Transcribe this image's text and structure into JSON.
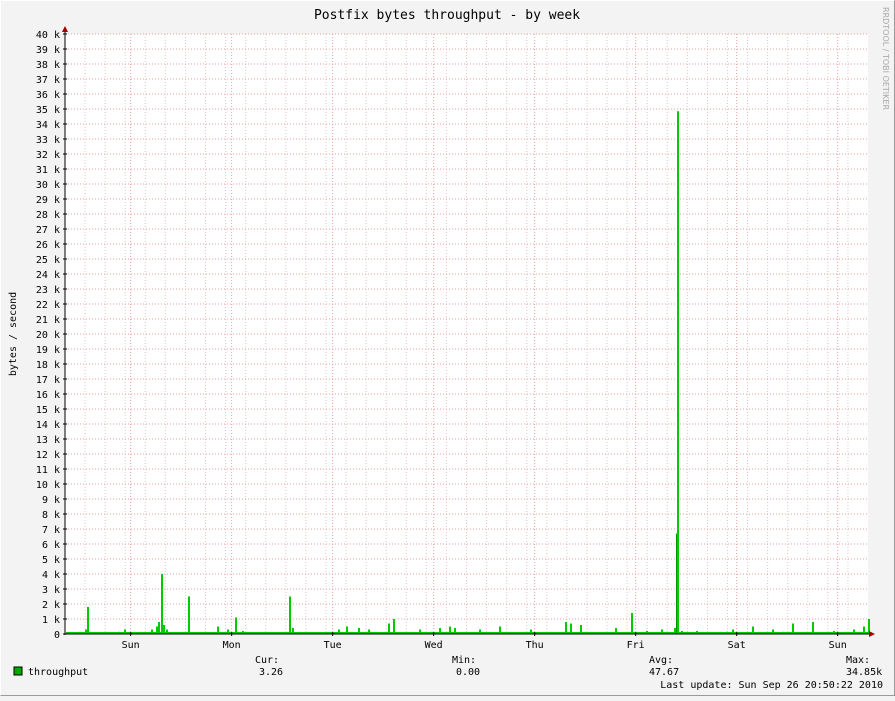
{
  "chart_data": {
    "type": "area",
    "title": "Postfix bytes throughput - by week",
    "ylabel": "bytes / second",
    "watermark": "RRDTOOL / TOBI OETIKER",
    "ylim": [
      0,
      40000
    ],
    "yticks": [
      {
        "value": 0,
        "label": "0"
      },
      {
        "value": 1000,
        "label": "1 k"
      },
      {
        "value": 2000,
        "label": "2 k"
      },
      {
        "value": 3000,
        "label": "3 k"
      },
      {
        "value": 4000,
        "label": "4 k"
      },
      {
        "value": 5000,
        "label": "5 k"
      },
      {
        "value": 6000,
        "label": "6 k"
      },
      {
        "value": 7000,
        "label": "7 k"
      },
      {
        "value": 8000,
        "label": "8 k"
      },
      {
        "value": 9000,
        "label": "9 k"
      },
      {
        "value": 10000,
        "label": "10 k"
      },
      {
        "value": 11000,
        "label": "11 k"
      },
      {
        "value": 12000,
        "label": "12 k"
      },
      {
        "value": 13000,
        "label": "13 k"
      },
      {
        "value": 14000,
        "label": "14 k"
      },
      {
        "value": 15000,
        "label": "15 k"
      },
      {
        "value": 16000,
        "label": "16 k"
      },
      {
        "value": 17000,
        "label": "17 k"
      },
      {
        "value": 18000,
        "label": "18 k"
      },
      {
        "value": 19000,
        "label": "19 k"
      },
      {
        "value": 20000,
        "label": "20 k"
      },
      {
        "value": 21000,
        "label": "21 k"
      },
      {
        "value": 22000,
        "label": "22 k"
      },
      {
        "value": 23000,
        "label": "23 k"
      },
      {
        "value": 24000,
        "label": "24 k"
      },
      {
        "value": 25000,
        "label": "25 k"
      },
      {
        "value": 26000,
        "label": "26 k"
      },
      {
        "value": 27000,
        "label": "27 k"
      },
      {
        "value": 28000,
        "label": "28 k"
      },
      {
        "value": 29000,
        "label": "29 k"
      },
      {
        "value": 30000,
        "label": "30 k"
      },
      {
        "value": 31000,
        "label": "31 k"
      },
      {
        "value": 32000,
        "label": "32 k"
      },
      {
        "value": 33000,
        "label": "33 k"
      },
      {
        "value": 34000,
        "label": "34 k"
      },
      {
        "value": 35000,
        "label": "35 k"
      },
      {
        "value": 36000,
        "label": "36 k"
      },
      {
        "value": 37000,
        "label": "37 k"
      },
      {
        "value": 38000,
        "label": "38 k"
      },
      {
        "value": 39000,
        "label": "39 k"
      },
      {
        "value": 40000,
        "label": "40 k"
      }
    ],
    "xlim": [
      0,
      7.95
    ],
    "xticks": [
      {
        "value": 0.65,
        "label": "Sun"
      },
      {
        "value": 1.65,
        "label": "Mon"
      },
      {
        "value": 2.65,
        "label": "Tue"
      },
      {
        "value": 3.65,
        "label": "Wed"
      },
      {
        "value": 4.65,
        "label": "Thu"
      },
      {
        "value": 5.65,
        "label": "Fri"
      },
      {
        "value": 6.65,
        "label": "Sat"
      },
      {
        "value": 7.65,
        "label": "Sun"
      }
    ],
    "grid": true,
    "series": [
      {
        "name": "throughput",
        "color": "#00cc00",
        "spikes": [
          [
            0.22,
            1800
          ],
          [
            0.2,
            300
          ],
          [
            0.58,
            300
          ],
          [
            0.85,
            300
          ],
          [
            0.9,
            500
          ],
          [
            0.92,
            800
          ],
          [
            0.95,
            4000
          ],
          [
            0.97,
            600
          ],
          [
            1.0,
            300
          ],
          [
            1.22,
            2500
          ],
          [
            1.22,
            500
          ],
          [
            1.5,
            500
          ],
          [
            1.6,
            300
          ],
          [
            1.68,
            1100
          ],
          [
            1.75,
            200
          ],
          [
            2.22,
            2500
          ],
          [
            2.25,
            400
          ],
          [
            2.7,
            300
          ],
          [
            2.78,
            500
          ],
          [
            2.9,
            400
          ],
          [
            3.0,
            300
          ],
          [
            3.2,
            700
          ],
          [
            3.25,
            1000
          ],
          [
            3.5,
            300
          ],
          [
            3.7,
            400
          ],
          [
            3.8,
            500
          ],
          [
            3.85,
            400
          ],
          [
            4.1,
            300
          ],
          [
            4.3,
            500
          ],
          [
            4.6,
            300
          ],
          [
            4.95,
            800
          ],
          [
            5.0,
            700
          ],
          [
            5.1,
            600
          ],
          [
            5.45,
            400
          ],
          [
            5.6,
            1400
          ],
          [
            5.75,
            200
          ],
          [
            5.9,
            300
          ],
          [
            6.03,
            400
          ],
          [
            6.05,
            6700
          ],
          [
            6.06,
            34850
          ],
          [
            6.1,
            200
          ],
          [
            6.25,
            200
          ],
          [
            6.6,
            300
          ],
          [
            6.8,
            500
          ],
          [
            7.0,
            300
          ],
          [
            7.2,
            700
          ],
          [
            7.4,
            800
          ],
          [
            7.6,
            200
          ],
          [
            7.8,
            300
          ],
          [
            7.9,
            500
          ],
          [
            7.95,
            1000
          ],
          [
            8.0,
            700
          ],
          [
            8.1,
            500
          ],
          [
            8.15,
            400
          ]
        ]
      }
    ],
    "legend": {
      "label": "throughput",
      "cur_label": "Cur:",
      "cur_value": "3.26",
      "min_label": "Min:",
      "min_value": "0.00",
      "avg_label": "Avg:",
      "avg_value": "47.67",
      "max_label": "Max:",
      "max_value": "34.85k",
      "last_update": "Last update: Sun Sep 26 20:50:22 2010"
    }
  }
}
